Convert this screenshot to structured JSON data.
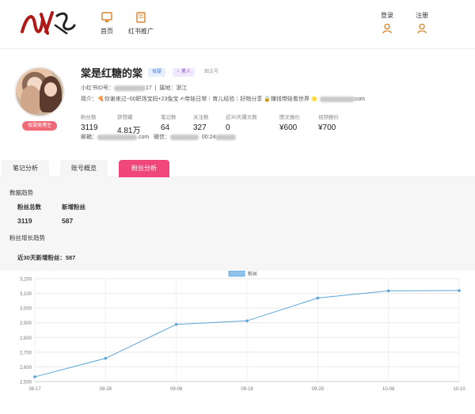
{
  "header": {
    "nav": [
      {
        "label": "首页",
        "icon": "monitor-icon"
      },
      {
        "label": "红书推广",
        "icon": "book-icon"
      }
    ],
    "login_label": "登录",
    "register_label": "注册"
  },
  "profile": {
    "name": "棠是红糖的棠",
    "badges": [
      "母婴",
      "素人",
      "图文号"
    ],
    "tag_button": "母婴类博主",
    "id_prefix": "小红书ID号：",
    "id_tail": "17",
    "location": "属地：浙江",
    "intro": "简介：🍕你谢来过~00职场宝妈+23兔宝 ✍帝娃日常｜育儿经验｜好物分享 🔒赚钱带娃看世界 🌟",
    "intro_tail": "com",
    "email_label": "邮箱：",
    "email_tail": ".com",
    "wechat_label": "微信：",
    "wechat_tail": "00:24",
    "stats": [
      {
        "label": "粉丝数",
        "value": "3119"
      },
      {
        "label": "获赞藏",
        "value": "4.81万"
      },
      {
        "label": "笔记数",
        "value": "64"
      },
      {
        "label": "关注数",
        "value": "327"
      },
      {
        "label": "近30天爆文数",
        "value": "0"
      },
      {
        "label": "图文报价",
        "value": "¥600"
      },
      {
        "label": "视频报价",
        "value": "¥700"
      }
    ]
  },
  "tabs": [
    {
      "label": "笔记分析",
      "active": false
    },
    {
      "label": "账号概览",
      "active": false
    },
    {
      "label": "粉丝分析",
      "active": true
    }
  ],
  "analysis": {
    "trend_title": "数据趋势",
    "fans_total_label": "粉丝总数",
    "fans_total_value": "3119",
    "new_fans_label": "新增粉丝",
    "new_fans_value": "587",
    "growth_title": "粉丝增长趋势",
    "growth_summary": "近30天新增粉丝：587"
  },
  "colors": {
    "accent": "#f0477a",
    "line": "#5aa6d6"
  },
  "chart_data": {
    "type": "line",
    "legend": [
      "粉丝"
    ],
    "legend_position": "top-center",
    "x": [
      "08-17",
      "08-28",
      "09-06",
      "09-18",
      "09-29",
      "10-08",
      "10-10"
    ],
    "series": [
      {
        "name": "粉丝",
        "values": [
          2532,
          2658,
          2889,
          2913,
          3068,
          3117,
          3119
        ]
      }
    ],
    "ylim": [
      2500,
      3200
    ],
    "yticks": [
      "2,500",
      "2,600",
      "2,700",
      "2,800",
      "2,900",
      "3,000",
      "3,100",
      "3,200"
    ],
    "grid": true
  }
}
